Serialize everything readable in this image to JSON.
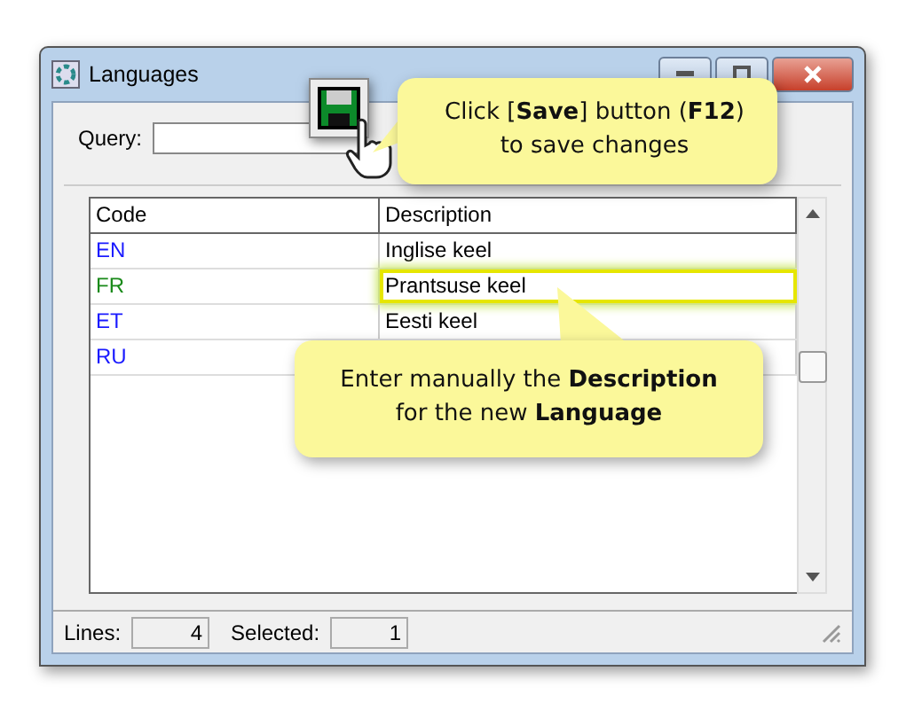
{
  "window": {
    "title": "Languages"
  },
  "query": {
    "label": "Query:"
  },
  "table": {
    "columns": [
      "Code",
      "Description"
    ],
    "rows": [
      {
        "code": "EN",
        "description": "Inglise keel",
        "color": "#1a1aff",
        "editing": false
      },
      {
        "code": "FR",
        "description": "Prantsuse keel",
        "color": "#1a8a1a",
        "editing": true
      },
      {
        "code": "ET",
        "description": "Eesti keel",
        "color": "#1a1aff",
        "editing": false
      },
      {
        "code": "RU",
        "color": "#1a1aff",
        "editing": false
      }
    ]
  },
  "status_bar": [
    {
      "label": "Lines:",
      "value": "4"
    },
    {
      "label": "Selected:",
      "value": "1"
    }
  ],
  "callouts": [
    {
      "kind": "save",
      "text": "Click [**Save**] button (**F12**) to save changes"
    },
    {
      "kind": "edit",
      "text": "Enter manually the **Description** for the new **Language**"
    }
  ]
}
